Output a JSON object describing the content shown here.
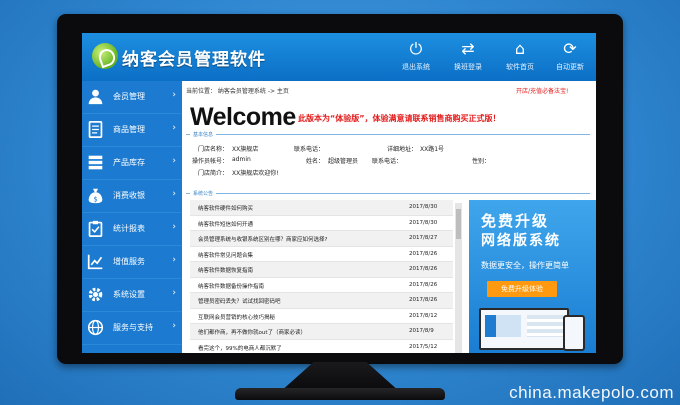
{
  "app": {
    "title": "纳客会员管理软件"
  },
  "toolbar": [
    {
      "label": "退出系统",
      "icon": "power-icon",
      "glyph": "⏻"
    },
    {
      "label": "换班登录",
      "icon": "switch-user-icon",
      "glyph": "⇄"
    },
    {
      "label": "软件首页",
      "icon": "home-icon",
      "glyph": "⌂"
    },
    {
      "label": "自动更新",
      "icon": "refresh-icon",
      "glyph": "⟳"
    }
  ],
  "sidebar": {
    "items": [
      {
        "label": "会员管理",
        "icon": "user-icon"
      },
      {
        "label": "商品管理",
        "icon": "document-icon"
      },
      {
        "label": "产品库存",
        "icon": "database-icon"
      },
      {
        "label": "消费收银",
        "icon": "money-bag-icon"
      },
      {
        "label": "统计报表",
        "icon": "clipboard-icon"
      },
      {
        "label": "增值服务",
        "icon": "chart-icon"
      },
      {
        "label": "系统设置",
        "icon": "gear-icon"
      },
      {
        "label": "服务与支持",
        "icon": "globe-icon"
      }
    ]
  },
  "breadcrumb": "当前位置： 纳客会员管理系统 -> 主页",
  "notice": "开店/充值必备法宝!",
  "welcome": "Welcome",
  "trial_notice": "此版本为“体验版”，体验满意请联系销售商购买正式版！",
  "basic_info": {
    "title": "基本信息",
    "store_name_label": "门店名称：",
    "store_name": "XX旗舰店",
    "phone_label": "联系电话：",
    "address_label": "详细地址：",
    "address": "XX路1号",
    "operator_label": "操作员帐号：",
    "operator": "admin",
    "name_label": "姓名：",
    "name": "超级管理员",
    "contact_phone_label": "联系电话：",
    "gender_label": "性别：",
    "intro_label": "门店简介：",
    "intro": "XX旗舰店欢迎你!"
  },
  "announcements": {
    "title": "系统公告",
    "rows": [
      {
        "title": "纳客软件硬件如何购买",
        "date": "2017/8/30"
      },
      {
        "title": "纳客软件短信如何开通",
        "date": "2017/8/30"
      },
      {
        "title": "会员管理系统与收银系统区别在哪？商家应如何选择?",
        "date": "2017/8/27"
      },
      {
        "title": "纳客软件常见问题合集",
        "date": "2017/8/26"
      },
      {
        "title": "纳客软件数据恢复指南",
        "date": "2017/8/26"
      },
      {
        "title": "纳客软件数据备份操作指南",
        "date": "2017/8/26"
      },
      {
        "title": "管理员密码丢失？试试找回密码吧",
        "date": "2017/8/26"
      },
      {
        "title": "互联网会员营销的核心技巧揭秘",
        "date": "2017/8/12"
      },
      {
        "title": "他们都作商，再不做你就out了（商家必读）",
        "date": "2017/8/9"
      },
      {
        "title": "看完这个，99%的电商人都沉默了",
        "date": "2017/5/12"
      }
    ]
  },
  "promo": {
    "line1": "免费升级",
    "line2": "网络版系统",
    "line3": "数据更安全，操作更简单",
    "button": "免费升级体验"
  },
  "watermark": "china.makepolo.com"
}
